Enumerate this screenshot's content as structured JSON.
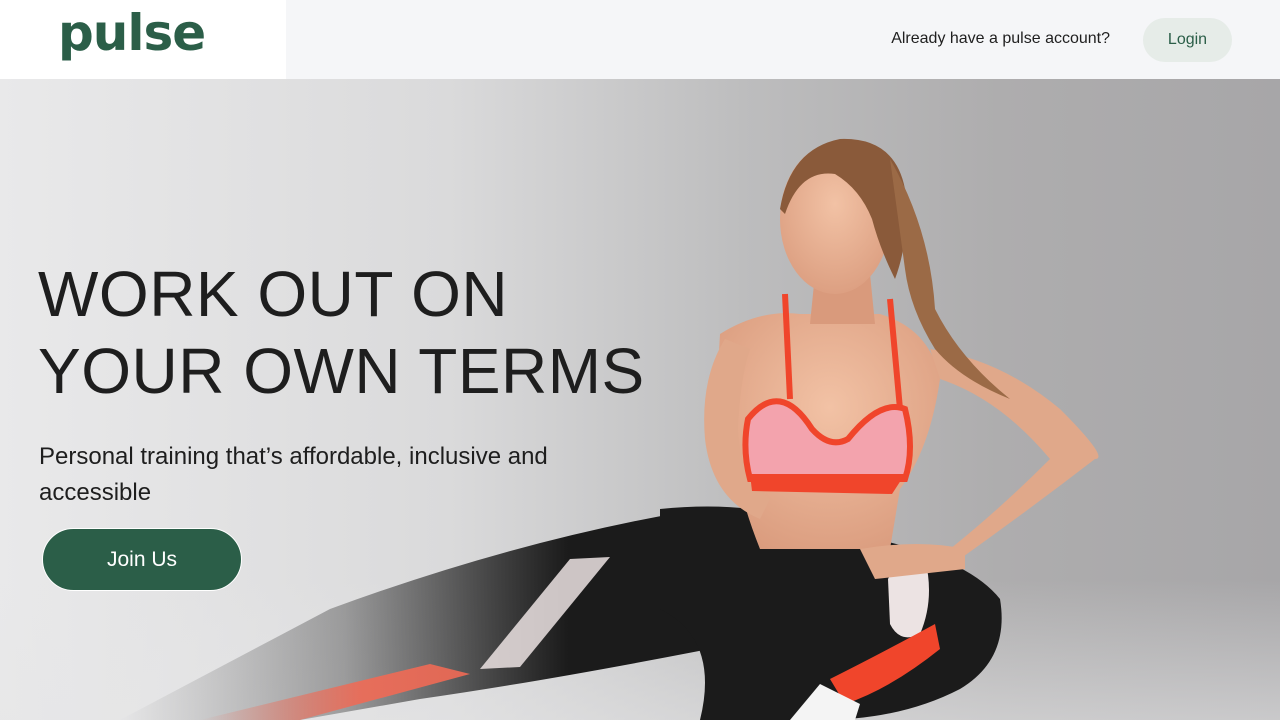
{
  "header": {
    "logo_text": "pulse",
    "account_prompt": "Already have a pulse account?",
    "login_label": "Login"
  },
  "hero": {
    "headline_line1": "WORK OUT ON",
    "headline_line2": "YOUR OWN TERMS",
    "subtitle": "Personal training that’s affordable, inclusive and accessible",
    "join_label": "Join Us",
    "image_subject": "woman-stretching-photo"
  },
  "colors": {
    "brand_green": "#2b5e48",
    "login_bg": "#e6ece8",
    "text_dark": "#1e1e1e"
  }
}
